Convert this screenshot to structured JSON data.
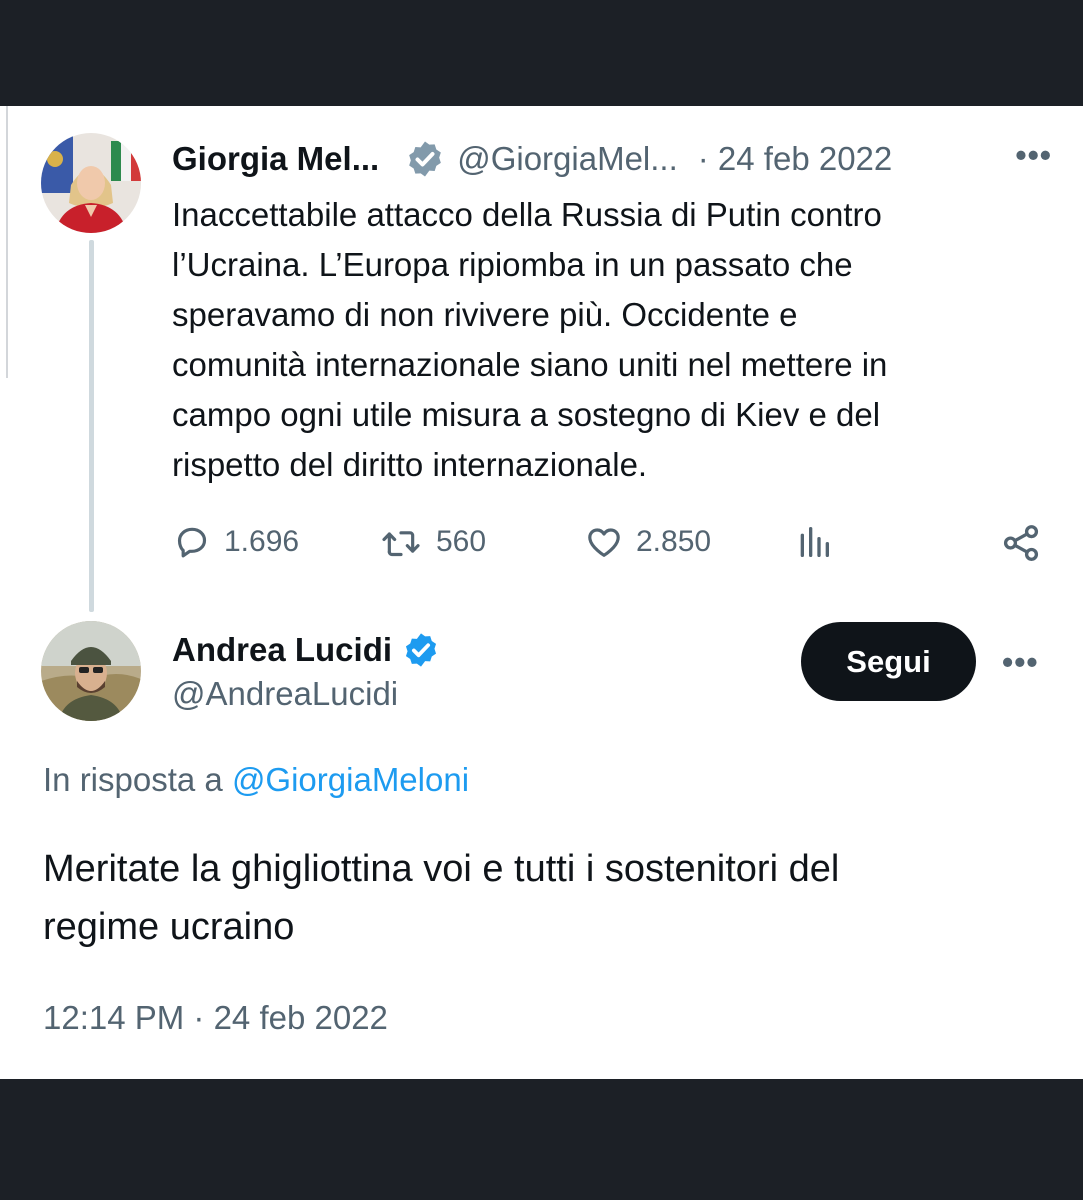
{
  "original_tweet": {
    "author_name": "Giorgia Mel...",
    "author_handle": "@GiorgiaMel...",
    "date": "· 24 feb 2022",
    "more_icon": "more-dots-icon",
    "verified_color": "#829aab",
    "text_lines": [
      "Inaccettabile attacco della Russia di Putin contro",
      "l’Ucraina. L’Europa ripiomba in un passato che",
      "speravamo di non rivivere più. Occidente e",
      "comunità internazionale siano uniti nel mettere in",
      "campo ogni utile misura a sostegno di Kiev e del",
      "rispetto del diritto internazionale."
    ],
    "metrics": {
      "replies": "1.696",
      "retweets": "560",
      "likes": "2.850"
    }
  },
  "reply_tweet": {
    "author_name": "Andrea Lucidi",
    "author_handle": "@AndreaLucidi",
    "follow_label": "Segui",
    "verified_color": "#1d9bf0",
    "reply_prefix": "In risposta a",
    "reply_target": "@GiorgiaMeloni",
    "text_lines": [
      "Meritate la ghigliottina voi e tutti i sostenitori del",
      "regime ucraino"
    ],
    "timestamp": "12:14 PM · 24 feb 2022"
  },
  "colors": {
    "background": "#1c2026",
    "card": "#ffffff",
    "text_primary": "#0f1419",
    "text_secondary": "#536471",
    "link": "#1d9bf0"
  }
}
